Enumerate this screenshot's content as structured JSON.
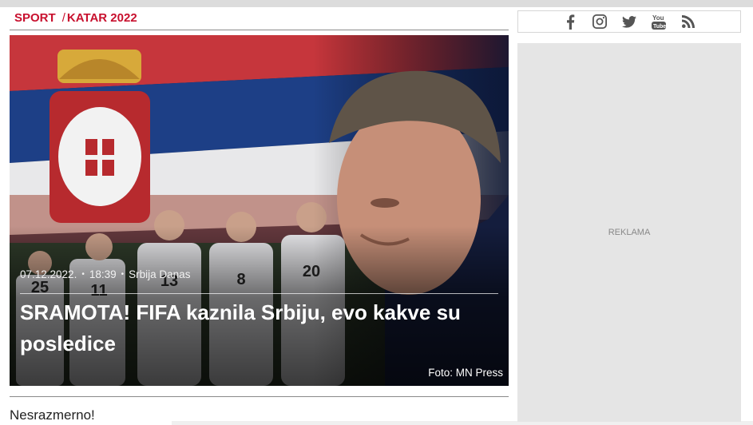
{
  "breadcrumb": {
    "section": "SPORT",
    "separator": "/",
    "subsection": "KATAR 2022"
  },
  "article": {
    "date": "07.12.2022.",
    "time": "18:39",
    "source": "Srbija Danas",
    "title": "SRAMOTA! FIFA kaznila Srbiju, evo kakve su posledice",
    "photo_credit": "Foto: MN Press",
    "lead": "Nesrazmerno!",
    "jersey_numbers": [
      "25",
      "11",
      "13",
      "8",
      "20"
    ]
  },
  "social": {
    "icons": [
      "facebook-icon",
      "instagram-icon",
      "twitter-icon",
      "youtube-icon",
      "rss-icon"
    ]
  },
  "ad": {
    "label": "REKLAMA"
  },
  "colors": {
    "accent": "#c8102e",
    "flag_red": "#c6363c",
    "flag_blue": "#0c4076",
    "flag_white": "#ffffff"
  }
}
